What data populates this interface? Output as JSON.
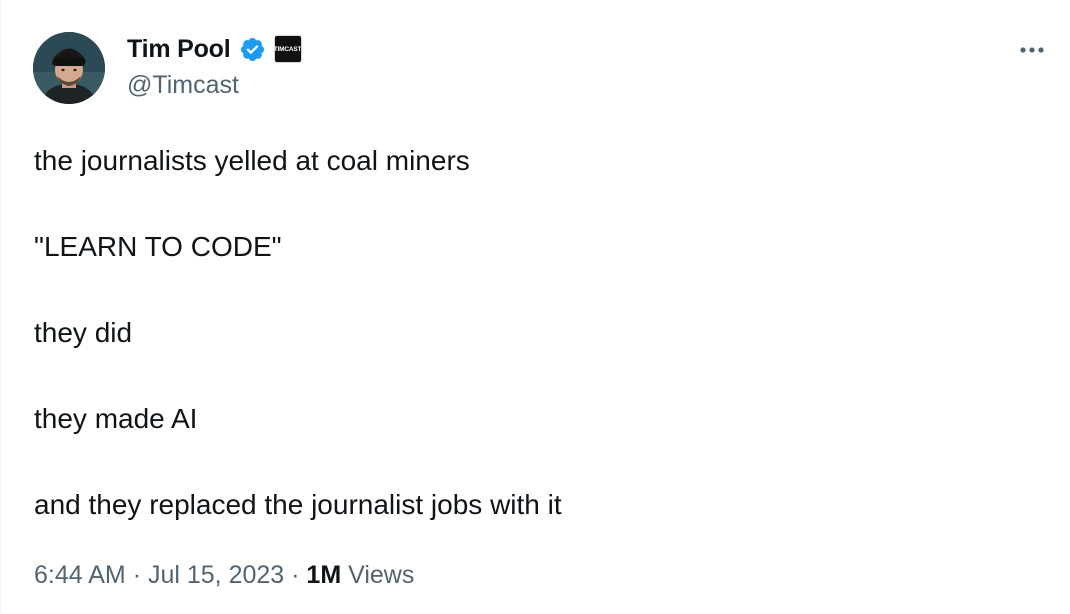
{
  "author": {
    "display_name": "Tim Pool",
    "handle": "@Timcast",
    "affiliate_badge_text": "TIMCAST",
    "verified_color": "#1d9bf0"
  },
  "tweet": {
    "lines": [
      "the journalists yelled at coal miners",
      "\"LEARN TO CODE\"",
      "they did",
      "they made AI",
      "and they replaced the journalist jobs with it"
    ]
  },
  "meta": {
    "time": "6:44 AM",
    "separator": "·",
    "date": "Jul 15, 2023",
    "views_count": "1M",
    "views_label": "Views"
  },
  "icons": {
    "more": "more-horizontal-icon",
    "verified": "verified-badge-icon"
  }
}
